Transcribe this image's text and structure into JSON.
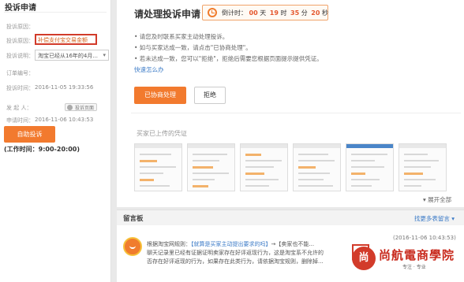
{
  "sidebar": {
    "title": "投诉申请",
    "fields": [
      {
        "label": "投诉原因：",
        "value": ""
      },
      {
        "label": "投诉原因：",
        "value": "补偿支付宝交易金额"
      },
      {
        "label": "投诉说明：",
        "value": "淘宝已经从16年的4月..."
      },
      {
        "label": "订单编号：",
        "value": ""
      },
      {
        "label": "投诉时间：",
        "value": "2016-11-05 19:33:56"
      },
      {
        "label": "发 起 人：",
        "value": "",
        "badge": "投诉页面"
      },
      {
        "label": "申请时间：",
        "value": "2016-11-06 10:43:53"
      }
    ],
    "button_label": "自助投诉",
    "hours": "(工作时间：9:00-20:00)"
  },
  "main": {
    "title": "请处理投诉申请",
    "countdown": {
      "prefix": "倒计时：",
      "days": "00",
      "days_unit": "天",
      "hours": "19",
      "hours_unit": "时",
      "minutes": "35",
      "minutes_unit": "分",
      "seconds": "20",
      "seconds_unit": "秒"
    },
    "tips": [
      "• 请您及时联系买家主动处理投诉。",
      "• 如与买家达成一致，请点击\"已协商处理\"。",
      "• 若未达成一致，您可以\"拒绝\"，拒绝后需要您根据页面提示提供凭证。"
    ],
    "tips_link": "快速怎么办",
    "accept_button": "已协商处理",
    "reject_button": "拒绝",
    "evidence_title": "买家已上传的凭证",
    "expand_label": "展开全部"
  },
  "messages": {
    "title": "留言板",
    "more_label": "找更多表留言",
    "item": {
      "time": "(2016-11-06 10:43:53)",
      "line1_a": "根据淘宝网规则：",
      "line1_link": "【就算是买家主动提出要求的吗】",
      "line1_b": "→【卖家也不能...",
      "line2": "聊天记录里已经有证据证明卖家存在好评返现行为，这是淘宝系不允许的",
      "line3": "否存在好评返现的行为，如果存在此类行为，请依据淘宝规则，删除掉..."
    }
  },
  "watermark": {
    "text": "尚航電商學院",
    "sub": "专注 · 专业"
  }
}
